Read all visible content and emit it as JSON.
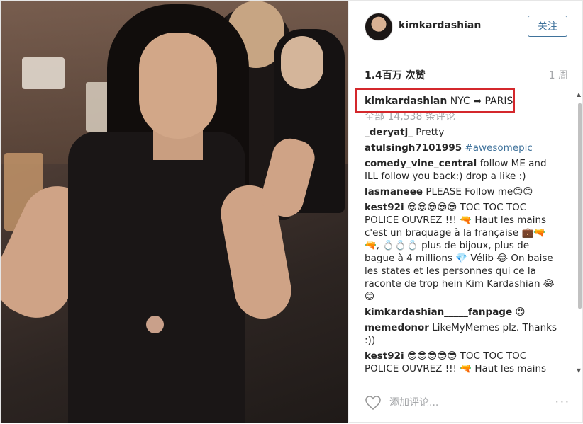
{
  "post": {
    "username": "kimkardashian",
    "follow_label": "关注",
    "likes": "1.4百万 次赞",
    "time_ago": "1 周",
    "caption": {
      "user": "kimkardashian",
      "text": "NYC ➡ PARIS"
    },
    "all_comments": "全部 14,538 条评论",
    "comments": [
      {
        "user": "_deryatj_",
        "text": "Pretty"
      },
      {
        "user": "atulsingh7101995",
        "text": "#awesomepic"
      },
      {
        "user": "comedy_vine_central",
        "text": "follow ME and ILL follow you back:) drop a like :)"
      },
      {
        "user": "lasmaneee",
        "text": "PLEASE Follow me😊😊"
      },
      {
        "user": "kest92i",
        "text": "😎😎😎😎😎 TOC TOC TOC POLICE OUVREZ !!! 🔫 Haut les mains c'est un braquage à la française 💼🔫🔫, 💍💍💍 plus de bijoux, plus de bague à 4 millions 💎 Vélib 😂 On baise les states et les personnes qui ce la raconte de trop hein Kim Kardashian 😂😊"
      },
      {
        "user": "kimkardashian_____fanpage",
        "text": "😍"
      },
      {
        "user": "memedonor",
        "text": "LikeMyMemes plz. Thanks :))"
      },
      {
        "user": "kest92i",
        "text": "😎😎😎😎😎 TOC TOC TOC POLICE OUVREZ !!! 🔫 Haut les mains"
      }
    ],
    "add_comment_placeholder": "添加评论...",
    "more_label": "···"
  },
  "colors": {
    "accent": "#3f729b",
    "highlight": "#d4282c",
    "muted": "#a5a7aa"
  },
  "icons": {
    "like": "heart-outline-icon",
    "more": "ellipsis-icon"
  }
}
